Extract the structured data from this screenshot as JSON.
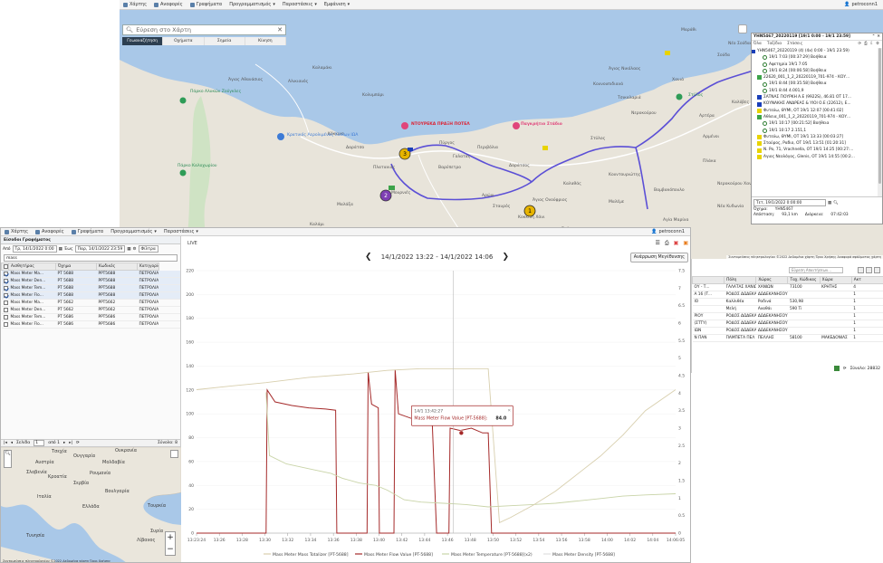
{
  "map_window": {
    "menu": [
      "Χάρτης",
      "Αναφορές",
      "Γραφήματα",
      "Προγραμματισμός",
      "Παραστάσεις",
      "Εμφάνιση"
    ],
    "user": "petroconn1",
    "search_placeholder": "Εύρεση στο Χάρτη",
    "tabs": [
      "Γεωαναζήτηση",
      "Οχήματα",
      "Σημεία",
      "Κίνηση"
    ],
    "active_tab": 0,
    "labels": {
      "agios_nikolaos": "Άγιος Νικόλαος",
      "kokkino": "Κόκκινο",
      "agios_gerasimos": "Άγιος Αθανάσιος",
      "alikianos": "Αλικιανός",
      "kalamaki": "Καλαμάκι",
      "kartalis": "Κουντουριώτης",
      "kolympari": "Κολυμπάρι",
      "marathi": "Μαράθι",
      "nea_kydonia": "Νέα Κυδωνία",
      "tsiki": "Τσικαλαριά",
      "kounoupidiana": "Κουνουπιδιανά",
      "nerokourou": "Νεροκούρου",
      "chania": "Χανιά",
      "souda": "Σούδα",
      "galatas": "Γαλατάς",
      "pyrgos": "Πύργος",
      "aptera": "Αρτέρα",
      "stylos": "Στύλος",
      "kalyves": "Καλύβες",
      "armeni": "Αρμένοι",
      "plaka": "Πλάκα",
      "daratso": "Δαράτσο",
      "agia_marina": "Αγία Μαρίνα",
      "platanias": "Πλατανιάς",
      "airport": "Κρατικός Αερολιμένας Χανίων ΙΩΑ",
      "zoo_park": "Πάρκο Αλυκών Ζούγκλες",
      "tables_park": "Πάρκο Καλοχωρίου",
      "perivolia": "Περιβόλια",
      "varypetro": "Βαρύπετρο",
      "mournies": "Μουρνιές",
      "malaxa": "Μαλάξα",
      "kalami": "Καλάμι",
      "kokkini_chani": "Κοκκίνη Χάνι",
      "aroni": "Αρώνι",
      "stavros": "Σταυρός",
      "sternes": "Στέρνες",
      "souda_port": "Νέο Σούδας",
      "kalathas": "Καλαθάς",
      "daratsos": "Δαράτσος",
      "vamvakopoulo": "Βαμβακόπουλο",
      "mitros": "Μαλέμε",
      "agios_onoufrios": "Άγιος Ονούφριος",
      "nerokourou2": "Νεροκούρου Χανίων",
      "poi1": "ΝΤΟΥΡΕΚΑ ΠΡΑΞΗ ΠΟΤΕΛ",
      "poi2": "Παγκρήτιο Στάδιο",
      "poi3": "Ηλιακτία Πετροχημικών"
    },
    "markers": [
      "1",
      "2",
      "3"
    ],
    "footer": "Συντομεύσεις πληκτρολογίου   ©2022 Δεδομένα χάρτη   Όροι Χρήσης   Αναφορά σφάλματος χάρτη"
  },
  "trip_panel": {
    "title": "ΥΗΝ5467_20220119 [19/1 0:00 - 19/1 23:59]",
    "sub_items": [
      "Όλα",
      "Ταξίδια",
      "Στάσεις"
    ],
    "rows": [
      {
        "icon": "square",
        "text": "ΥΗΝ5467_20220119 (4) (4x) 0:00 - 19/1 23:59)"
      },
      {
        "icon": "circle",
        "text": "19/1 7:03 [00:37:29] Βοήθεια"
      },
      {
        "icon": "circle",
        "text": "Αφετηρία 19/1 7:05"
      },
      {
        "icon": "circle",
        "text": "19/1 8:24 [00:06:58] Βοήθεια"
      },
      {
        "icon": "flag-green",
        "text": "22620_001_1_2_20220119_701-974 - ΚΟΥ..."
      },
      {
        "icon": "circle",
        "text": "19/1 8:44 [00:35:58] Βοήθεια"
      },
      {
        "icon": "circle",
        "text": "19/1 8:44 4.001,9"
      },
      {
        "icon": "flag-blue",
        "text": "ΣΑΤΝΑΣ ΓΙΟΥΡΚΗ Α.Ε (9922S), 46.81 ΟΤ 17..."
      },
      {
        "icon": "flag-blue",
        "text": "ΚΟΥΝΑΚΗΣ ΑΝΔΡΕΑΣ & ΥΙΟΙ Ο.Ε (22612), Ε..."
      },
      {
        "icon": "flag-yellow",
        "text": "Φυτεύω, ΘΥΜΙ, ΟΤ 19/1 12:07 [00:41:02]"
      },
      {
        "icon": "flag-green",
        "text": "Αθλεια_001_1_2_20220119_701-974 - ΚΟΥ..."
      },
      {
        "icon": "circle",
        "text": "19/1 10:17 [00:21:52] Βοήθεια"
      },
      {
        "icon": "circle",
        "text": "19/1 10:17 2.151,1"
      },
      {
        "icon": "flag-yellow",
        "text": "Φυτεύω, ΘΥΜΙ, ΟΤ 19/1 13:33 [00:03:27]"
      },
      {
        "icon": "flag-yellow",
        "text": "Σταύρος, Ραδιο, ΟΤ 19/1 13:51 [01:20:31]"
      },
      {
        "icon": "flag-yellow",
        "text": "Ν. Ρο, 71, Vrachnella, ΟΤ 19/1 14:25 [00:27:..."
      },
      {
        "icon": "flag-yellow",
        "text": "Αγιος Νεολόγος, Glenis, ΟΤ 19/1 14:55 [00:2..."
      }
    ],
    "date_field": "Τετ, 19/1/2022 0:00:00",
    "vehicle_label": "Όχημα:",
    "vehicle_value": "ΥΗΝ5467",
    "distance_label": "Απόσταση:",
    "distance_value": "93,1 km",
    "duration_label": "Διάρκεια:",
    "duration_value": "07:42:03"
  },
  "data_window": {
    "menu": [
      "Χάρτης",
      "Αναφορές",
      "Γραφήματα",
      "Προγραμματισμός",
      "Παραστάσεις"
    ],
    "user": "petroconn1",
    "panel_title": "Είσοδοι Γραφήματος",
    "from_label": "Από",
    "from_value": "Τρ, 14/1/2022 0:00",
    "to_label": "Έως",
    "to_value": "Παρ, 14/1/2022 23:59",
    "filters_label": "Φίλτρα",
    "filter_text": "mass",
    "columns": [
      "Αισθητήρας",
      "Όχημα",
      "Κωδικός",
      "Κατηγορία"
    ],
    "rows": [
      {
        "checked": true,
        "sensor": "Mass Meter Ma...",
        "vehicle": "ΡΤ 5688",
        "code": "ΡΡΤ5688",
        "category": "ΠΕΤΡΟΛΙΑΣ ΕΥΤΙΑ"
      },
      {
        "checked": true,
        "sensor": "Mass Meter Den...",
        "vehicle": "ΡΤ 5688",
        "code": "ΡΡΤ5688",
        "category": "ΠΕΤΡΟΛΙΑΣ ΕΥΤΙΑ"
      },
      {
        "checked": true,
        "sensor": "Mass Meter Tem...",
        "vehicle": "ΡΤ 5688",
        "code": "ΡΡΤ5688",
        "category": "ΠΕΤΡΟΛΙΑΣ ΕΥΤΙΑ"
      },
      {
        "checked": true,
        "sensor": "Mass Meter Flo...",
        "vehicle": "ΡΤ 5688",
        "code": "ΡΡΤ5688",
        "category": "ΠΕΤΡΟΛΙΑΣ ΕΥΤΙΑ"
      },
      {
        "checked": false,
        "sensor": "Mass Meter Ma...",
        "vehicle": "ΡΤ 5662",
        "code": "ΡΡΤ5662",
        "category": "ΠΕΤΡΟΛΙΑΣ ΕΥΤΙΑ"
      },
      {
        "checked": false,
        "sensor": "Mass Meter Den...",
        "vehicle": "ΡΤ 5662",
        "code": "ΡΡΤ5662",
        "category": "ΠΕΤΡΟΛΙΑΣ ΕΥΤΙΑ"
      },
      {
        "checked": false,
        "sensor": "Mass Meter Tem...",
        "vehicle": "ΡΤ 5686",
        "code": "ΡΡΤ5686",
        "category": "ΠΕΤΡΟΛΙΑΣ ΕΥΤΙΑ"
      },
      {
        "checked": false,
        "sensor": "Mass Meter Flo...",
        "vehicle": "ΡΤ 5686",
        "code": "ΡΡΤ5686",
        "category": "ΠΕΤΡΟΛΙΑΣ ΕΥΤΙΑ"
      }
    ],
    "pager": {
      "page_label": "Σελίδα",
      "page": "1",
      "of": "από 1",
      "total": "Σύνολο: 8"
    },
    "map_labels": [
      "Τσεχία",
      "Αυστρία",
      "Ουγγαρία",
      "Μολδαβία",
      "Ουκρανία",
      "Σλοβενία",
      "Κροατία",
      "Ρουμανία",
      "Σερβία",
      "Βουλγαρία",
      "Ιταλία",
      "Ελλάδα",
      "Τουρκία",
      "Τυνησία",
      "Συρία",
      "Λίβανος"
    ],
    "map_footer": "Συντομεύσεις πληκτρολογίου   ©2022 Δεδομένα χάρτη   Όροι Χρήσης"
  },
  "chart": {
    "live_label": "LIVE",
    "range_label": "14/1/2022 13:22 - 14/1/2022 14:06",
    "reset_label": "Ανάρρωση Μεγέθυνσης",
    "tooltip_time": "14/1 13:42:27",
    "tooltip_series": "Mass Meter Flow Value [PT-5688]:",
    "tooltip_value": "84.0",
    "colors": {
      "totalizer": "#d8cfae",
      "flow": "#a52a2a",
      "temperature": "#c9d4a8",
      "density": "#e0e0e0"
    }
  },
  "chart_data": {
    "type": "line",
    "x_ticks": [
      "13:23:24",
      "13:26",
      "13:28",
      "13:30",
      "13:32",
      "13:34",
      "13:36",
      "13:38",
      "13:40",
      "13:42",
      "13:44",
      "13:46",
      "13:48",
      "13:50",
      "13:52",
      "13:54",
      "13:56",
      "13:58",
      "14:00",
      "14:02",
      "14:04",
      "14:06:05"
    ],
    "y_left_ticks": [
      "0",
      "20",
      "40",
      "60",
      "80",
      "100",
      "120",
      "140",
      "160",
      "180",
      "200",
      "220"
    ],
    "y_right_ticks": [
      "0",
      "0.5",
      "1",
      "1.5",
      "2",
      "2.5",
      "3",
      "3.5",
      "4",
      "4.5",
      "5",
      "5.5",
      "6",
      "6.5",
      "7",
      "7.5"
    ],
    "ylim_left": [
      0,
      220
    ],
    "ylim_right": [
      0,
      7.5
    ],
    "xlim_minutes": [
      0,
      42.7
    ],
    "legend": [
      "Mass Meter Mass Totalizer [PT-5688]",
      "Mass Meter Flow Value [PT-5688]",
      "Mass Meter Temperature [PT-5688](x2)",
      "Mass Meter Density [PT-5688]"
    ],
    "series": [
      {
        "name": "Mass Meter Flow Value [PT-5688]",
        "axis": "left",
        "points": [
          [
            0,
            0
          ],
          [
            6.2,
            0
          ],
          [
            6.3,
            120
          ],
          [
            7,
            110
          ],
          [
            8.5,
            107
          ],
          [
            10,
            105
          ],
          [
            11.5,
            104
          ],
          [
            12.4,
            103
          ],
          [
            12.5,
            0
          ],
          [
            15.2,
            0
          ],
          [
            15.3,
            135
          ],
          [
            15.6,
            108
          ],
          [
            16.2,
            105
          ],
          [
            16.3,
            0
          ],
          [
            17.6,
            0
          ],
          [
            17.7,
            137
          ],
          [
            18,
            100
          ],
          [
            19.5,
            95
          ],
          [
            21,
            94
          ],
          [
            21.4,
            0
          ],
          [
            22.5,
            0
          ],
          [
            22.6,
            88
          ],
          [
            23.5,
            86
          ],
          [
            24.5,
            88
          ],
          [
            25.5,
            84
          ],
          [
            26,
            84
          ],
          [
            26.3,
            0
          ],
          [
            42.7,
            0
          ]
        ]
      },
      {
        "name": "Mass Meter Temperature [PT-5688](x2)",
        "axis": "left",
        "points": [
          [
            6.2,
            118
          ],
          [
            6.5,
            65
          ],
          [
            8,
            58
          ],
          [
            10,
            54
          ],
          [
            12,
            50
          ],
          [
            13,
            46
          ],
          [
            14.5,
            42
          ],
          [
            16,
            40
          ],
          [
            17,
            36
          ],
          [
            18.5,
            28
          ],
          [
            20,
            26
          ],
          [
            22,
            25
          ],
          [
            24,
            24
          ],
          [
            26,
            22
          ],
          [
            28,
            23
          ],
          [
            30,
            24
          ],
          [
            32,
            25
          ],
          [
            34,
            27
          ],
          [
            36,
            29
          ],
          [
            38,
            31
          ],
          [
            40,
            32
          ],
          [
            42.7,
            33
          ]
        ]
      },
      {
        "name": "Mass Meter Mass Totalizer [PT-5688]",
        "axis": "right",
        "points": [
          [
            0,
            4.1
          ],
          [
            3,
            4.2
          ],
          [
            6.2,
            4.3
          ],
          [
            10,
            4.45
          ],
          [
            14,
            4.55
          ],
          [
            17,
            4.65
          ],
          [
            20,
            4.7
          ],
          [
            26,
            4.7
          ],
          [
            27,
            0.3
          ],
          [
            28,
            0.45
          ],
          [
            30,
            0.8
          ],
          [
            32,
            1.2
          ],
          [
            34,
            1.7
          ],
          [
            36,
            2.2
          ],
          [
            38,
            2.8
          ],
          [
            40,
            3.5
          ],
          [
            42.7,
            4.1
          ]
        ]
      }
    ],
    "cursor_x": 22.9,
    "tooltip_point": [
      23.6,
      84
    ]
  },
  "side_table": {
    "search_placeholder": "Εύρεση Απαιτήσεων...",
    "columns": [
      "",
      "Πόλη",
      "Χώρος",
      "Ταχ. Κώδικας",
      "Χώρα",
      "Ακτ"
    ],
    "rows": [
      [
        "ΟΥ - Τ...",
        "ΓΑΛΑΤΑΣ ΧΑΝΙΩΝ",
        "ΧΑΝΙΩΝ",
        "73100",
        "ΚΡΗΤΗΣ",
        "4"
      ],
      [
        "Α 16 (Τ...",
        "ΡΟΔΟΣ ΔΩΔΕΚΑ",
        "ΔΩΔΕΚΑΝΗΣΟΥ",
        "",
        "",
        "1"
      ],
      [
        "ΙΟ",
        "Καλλιθέα",
        "Ραδινά",
        "530,98",
        "",
        "1"
      ],
      [
        "",
        "Μελή",
        "Αναθάι",
        "590 Ti",
        "",
        "1"
      ],
      [
        "ΡΙΟΥ",
        "ΡΟΔΟΣ ΔΩΔΕΚΑ",
        "ΔΩΔΕΚΑΝΗΣΟΥ",
        "",
        "",
        "1"
      ],
      [
        "(ΣΤΤΥ)",
        "ΡΟΔΟΣ ΔΩΔΕΚΑ",
        "ΔΩΔΕΚΑΝΗΣΟΥ",
        "",
        "",
        "1"
      ],
      [
        "ΙΩΝ",
        "ΡΟΔΟΣ ΔΩΔΕΚΑ",
        "ΔΩΔΕΚΑΝΗΣΟΥ",
        "",
        "",
        "1"
      ],
      [
        "Ν ΠΑΝ",
        "ΠΑΜΠΕΤΑ ΠΕΛ",
        "ΠΕΛΛΗΣ",
        "58100",
        "ΜΑΚΕΔΟΝΙΑΣ",
        "1"
      ]
    ],
    "total": "Σύνολο: 28832"
  }
}
